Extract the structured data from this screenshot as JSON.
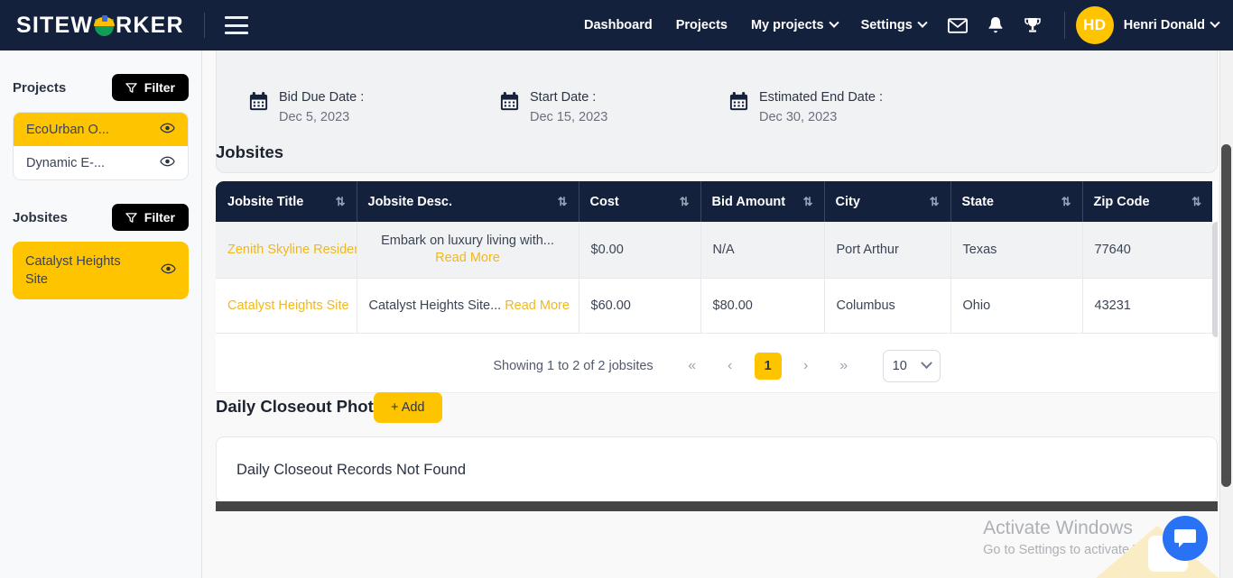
{
  "navbar": {
    "logo_prefix": "SITEW",
    "logo_suffix": "RKER",
    "logo_icon": "hardhat-icon",
    "menu_icon": "hamburger-menu-icon",
    "links": [
      {
        "label": "Dashboard",
        "has_caret": false
      },
      {
        "label": "Projects",
        "has_caret": false
      },
      {
        "label": "My projects",
        "has_caret": true
      },
      {
        "label": "Settings",
        "has_caret": true
      }
    ],
    "icons": [
      "mail-icon",
      "bell-icon",
      "trophy-icon"
    ],
    "avatar_initials": "HD",
    "user_name": "Henri Donald"
  },
  "sidebar": {
    "projects_title": "Projects",
    "projects_filter_label": "Filter",
    "projects": [
      {
        "label": "EcoUrban O...",
        "active": true
      },
      {
        "label": "Dynamic E-...",
        "active": false
      }
    ],
    "jobsites_title": "Jobsites",
    "jobsites_filter_label": "Filter",
    "jobsites": [
      {
        "label": "Catalyst Heights Site",
        "active": true
      }
    ]
  },
  "info_card": {
    "dates": [
      {
        "label": "Bid Due Date :",
        "value": "Dec 5, 2023",
        "icon": "calendar-icon"
      },
      {
        "label": "Start Date :",
        "value": "Dec 15, 2023",
        "icon": "calendar-icon"
      },
      {
        "label": "Estimated End Date :",
        "value": "Dec 30, 2023",
        "icon": "calendar-icon"
      }
    ]
  },
  "jobsites_section": {
    "title": "Jobsites",
    "columns": [
      "Jobsite Title",
      "Jobsite Desc.",
      "Cost",
      "Bid Amount",
      "City",
      "State",
      "Zip Code"
    ],
    "rows": [
      {
        "title": "Zenith Skyline Residen",
        "desc": "Embark on luxury living with...",
        "read_more": "Read More",
        "cost": "$0.00",
        "bid_amount": "N/A",
        "city": "Port Arthur",
        "state": "Texas",
        "zip": "77640"
      },
      {
        "title": "Catalyst Heights Site",
        "desc": "Catalyst Heights Site...",
        "read_more": "Read More",
        "cost": "$60.00",
        "bid_amount": "$80.00",
        "city": "Columbus",
        "state": "Ohio",
        "zip": "43231"
      }
    ],
    "pagination": {
      "showing_text": "Showing 1 to 2 of 2 jobsites",
      "first_label": "«",
      "prev_label": "‹",
      "current_page": "1",
      "next_label": "›",
      "last_label": "»",
      "page_size": "10"
    }
  },
  "closeout_section": {
    "title": "Daily Closeout Photos",
    "add_label": "+ Add",
    "empty_text": "Daily Closeout Records Not Found"
  },
  "watermark": {
    "title": "Activate Windows",
    "subtitle": "Go to Settings to activate Windows."
  },
  "chat": {
    "icon": "chat-bubble-icon"
  },
  "colors": {
    "navy": "#14213d",
    "yellow": "#ffc400",
    "link_yellow": "#f0b81f",
    "blue": "#2a72f5"
  }
}
